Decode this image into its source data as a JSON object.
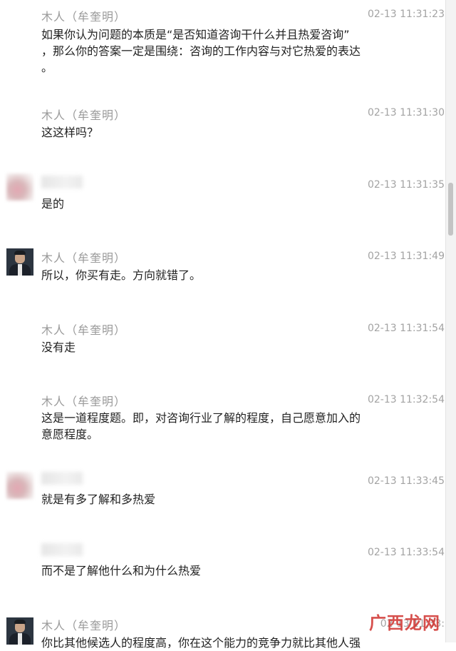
{
  "messages": [
    {
      "sender": "木人（牟奎明）",
      "time": "02-13 11:31:23",
      "text": "如果你认为问题的本质是“是否知道咨询干什么并且热爱咨询”\n，那么你的答案一定是围绕：咨询的工作内容与对它热爱的表达\n。",
      "avatar": "none"
    },
    {
      "sender": "木人（牟奎明）",
      "time": "02-13 11:31:30",
      "text": "这这样吗？",
      "avatar": "none"
    },
    {
      "sender": "",
      "time": "02-13 11:31:35",
      "text": "是的",
      "avatar": "blurred"
    },
    {
      "sender": "木人（牟奎明）",
      "time": "02-13 11:31:49",
      "text": "所以，你买有走。方向就错了。",
      "avatar": "man"
    },
    {
      "sender": "木人（牟奎明）",
      "time": "02-13 11:31:54",
      "text": "没有走",
      "avatar": "none"
    },
    {
      "sender": "木人（牟奎明）",
      "time": "02-13 11:32:54",
      "text": "这是一道程度题。即，对咨询行业了解的程度，自己愿意加入的\n意愿程度。",
      "avatar": "none"
    },
    {
      "sender": "",
      "time": "02-13 11:33:45",
      "text": "就是有多了解和多热爱",
      "avatar": "blurred"
    },
    {
      "sender": "",
      "time": "02-13 11:33:54",
      "text": "而不是了解他什么和为什么热爱",
      "avatar": "none"
    },
    {
      "sender": "木人（牟奎明）",
      "time": "02-13 11:33:",
      "text": "你比其他候选人的程度高，你在这个能力的竞争力就比其他人强",
      "avatar": "man"
    }
  ],
  "watermark": {
    "logo": "广西",
    "text": "广西龙网"
  },
  "colors": {
    "sender": "#9a9a9a",
    "time": "#a3a3a3",
    "text": "#222222",
    "watermark": "#d0312d"
  }
}
